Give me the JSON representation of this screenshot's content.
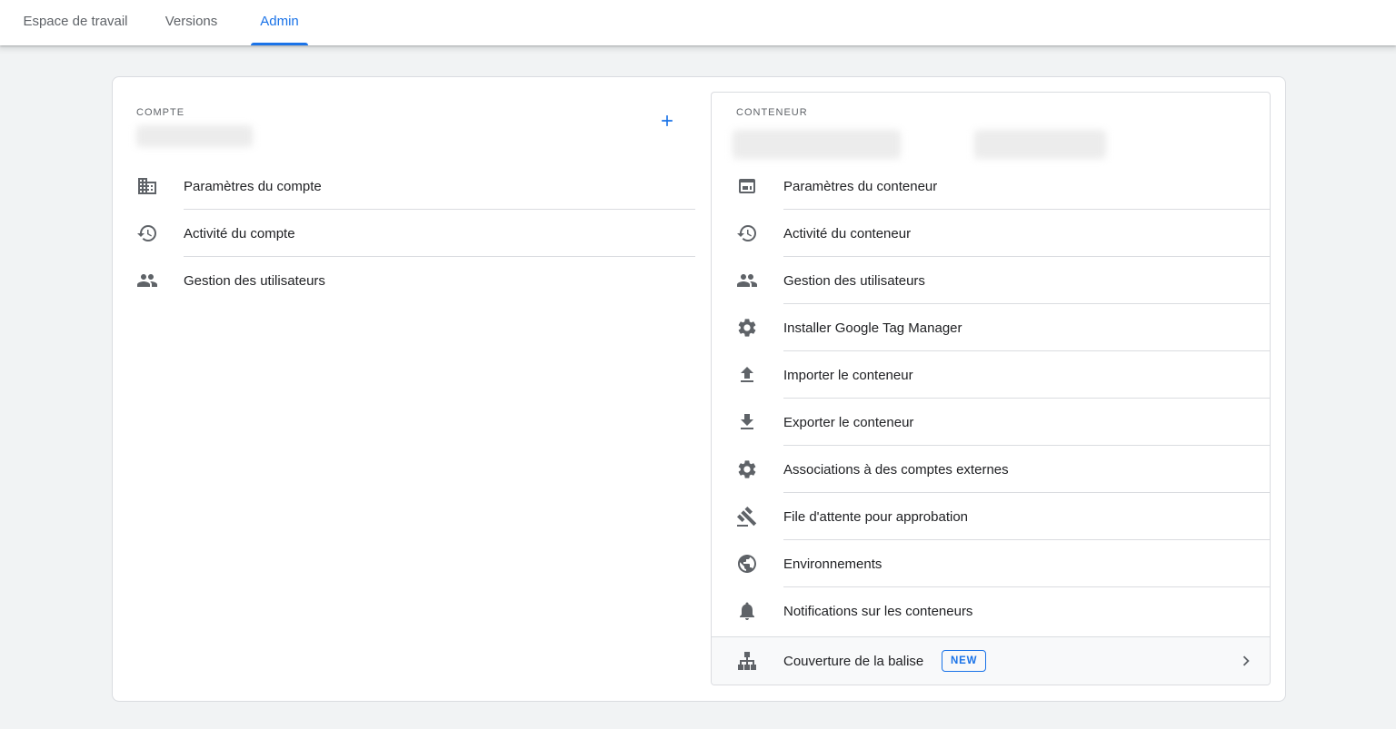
{
  "tabs": [
    {
      "label": "Espace de travail"
    },
    {
      "label": "Versions"
    },
    {
      "label": "Admin"
    }
  ],
  "account": {
    "section_label": "COMPTE",
    "add_icon": "add-icon",
    "items": [
      {
        "label": "Paramètres du compte",
        "icon": "domain-icon"
      },
      {
        "label": "Activité du compte",
        "icon": "history-icon"
      },
      {
        "label": "Gestion des utilisateurs",
        "icon": "people-icon"
      }
    ]
  },
  "container": {
    "section_label": "CONTENEUR",
    "items": [
      {
        "label": "Paramètres du conteneur",
        "icon": "web-asset-icon"
      },
      {
        "label": "Activité du conteneur",
        "icon": "history-icon"
      },
      {
        "label": "Gestion des utilisateurs",
        "icon": "people-icon"
      },
      {
        "label": "Installer Google Tag Manager",
        "icon": "settings-icon"
      },
      {
        "label": "Importer le conteneur",
        "icon": "upload-icon"
      },
      {
        "label": "Exporter le conteneur",
        "icon": "download-icon"
      },
      {
        "label": "Associations à des comptes externes",
        "icon": "settings-icon"
      },
      {
        "label": "File d'attente pour approbation",
        "icon": "gavel-icon"
      },
      {
        "label": "Environnements",
        "icon": "globe-icon"
      },
      {
        "label": "Notifications sur les conteneurs",
        "icon": "bell-icon"
      },
      {
        "label": "Couverture de la balise",
        "icon": "sitemap-icon",
        "badge": "NEW"
      }
    ]
  },
  "colors": {
    "accent": "#1a73e8",
    "icon": "#5f6368",
    "divider": "#dadce0",
    "background": "#f1f3f4"
  }
}
